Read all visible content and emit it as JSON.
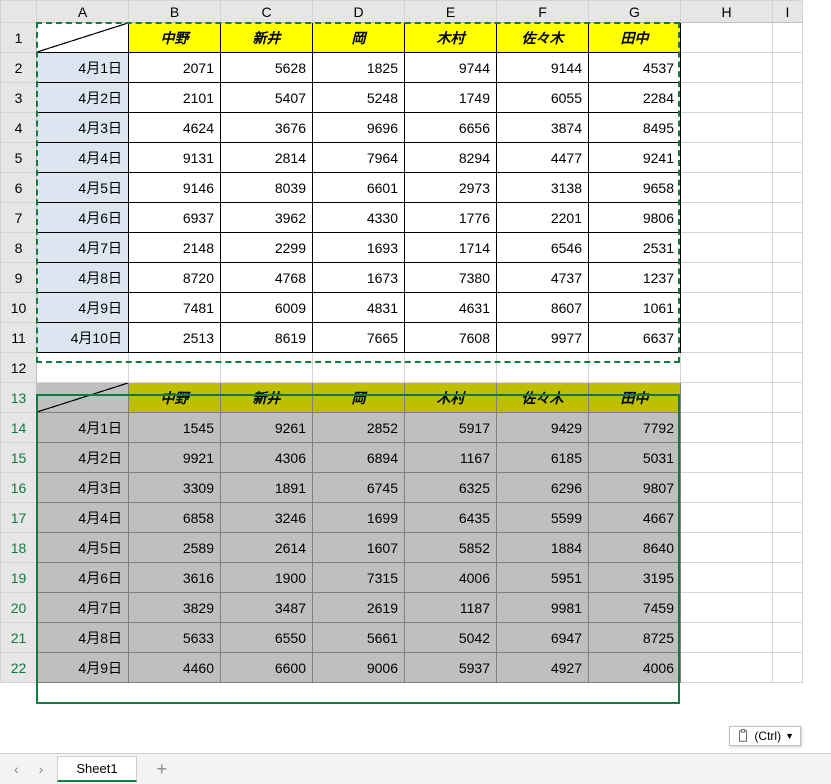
{
  "columns": [
    "A",
    "B",
    "C",
    "D",
    "E",
    "F",
    "G",
    "H",
    "I"
  ],
  "people": [
    "中野",
    "新井",
    "岡",
    "木村",
    "佐々木",
    "田中"
  ],
  "table1": {
    "dates": [
      "4月1日",
      "4月2日",
      "4月3日",
      "4月4日",
      "4月5日",
      "4月6日",
      "4月7日",
      "4月8日",
      "4月9日",
      "4月10日"
    ],
    "rows": [
      [
        2071,
        5628,
        1825,
        9744,
        9144,
        4537
      ],
      [
        2101,
        5407,
        5248,
        1749,
        6055,
        2284
      ],
      [
        4624,
        3676,
        9696,
        6656,
        3874,
        8495
      ],
      [
        9131,
        2814,
        7964,
        8294,
        4477,
        9241
      ],
      [
        9146,
        8039,
        6601,
        2973,
        3138,
        9658
      ],
      [
        6937,
        3962,
        4330,
        1776,
        2201,
        9806
      ],
      [
        2148,
        2299,
        1693,
        1714,
        6546,
        2531
      ],
      [
        8720,
        4768,
        1673,
        7380,
        4737,
        1237
      ],
      [
        7481,
        6009,
        4831,
        4631,
        8607,
        1061
      ],
      [
        2513,
        8619,
        7665,
        7608,
        9977,
        6637
      ]
    ]
  },
  "table2": {
    "dates": [
      "4月1日",
      "4月2日",
      "4月3日",
      "4月4日",
      "4月5日",
      "4月6日",
      "4月7日",
      "4月8日",
      "4月9日"
    ],
    "rows": [
      [
        1545,
        9261,
        2852,
        5917,
        9429,
        7792
      ],
      [
        9921,
        4306,
        6894,
        1167,
        6185,
        5031
      ],
      [
        3309,
        1891,
        6745,
        6325,
        6296,
        9807
      ],
      [
        6858,
        3246,
        1699,
        6435,
        5599,
        4667
      ],
      [
        2589,
        2614,
        1607,
        5852,
        1884,
        8640
      ],
      [
        3616,
        1900,
        7315,
        4006,
        5951,
        3195
      ],
      [
        3829,
        3487,
        2619,
        1187,
        9981,
        7459
      ],
      [
        5633,
        6550,
        5661,
        5042,
        6947,
        8725
      ],
      [
        4460,
        6600,
        9006,
        5937,
        4927,
        4006
      ]
    ]
  },
  "tabs": {
    "sheet": "Sheet1"
  },
  "paste_options": {
    "label": "(Ctrl)"
  },
  "chart_data": [
    {
      "type": "table",
      "title": "Table 1 (rows 1-11)",
      "columns": [
        "中野",
        "新井",
        "岡",
        "木村",
        "佐々木",
        "田中"
      ],
      "index": [
        "4月1日",
        "4月2日",
        "4月3日",
        "4月4日",
        "4月5日",
        "4月6日",
        "4月7日",
        "4月8日",
        "4月9日",
        "4月10日"
      ],
      "data": [
        [
          2071,
          5628,
          1825,
          9744,
          9144,
          4537
        ],
        [
          2101,
          5407,
          5248,
          1749,
          6055,
          2284
        ],
        [
          4624,
          3676,
          9696,
          6656,
          3874,
          8495
        ],
        [
          9131,
          2814,
          7964,
          8294,
          4477,
          9241
        ],
        [
          9146,
          8039,
          6601,
          2973,
          3138,
          9658
        ],
        [
          6937,
          3962,
          4330,
          1776,
          2201,
          9806
        ],
        [
          2148,
          2299,
          1693,
          1714,
          6546,
          2531
        ],
        [
          8720,
          4768,
          1673,
          7380,
          4737,
          1237
        ],
        [
          7481,
          6009,
          4831,
          4631,
          8607,
          1061
        ],
        [
          2513,
          8619,
          7665,
          7608,
          9977,
          6637
        ]
      ]
    },
    {
      "type": "table",
      "title": "Table 2 (rows 13-22, pasted selection)",
      "columns": [
        "中野",
        "新井",
        "岡",
        "木村",
        "佐々木",
        "田中"
      ],
      "index": [
        "4月1日",
        "4月2日",
        "4月3日",
        "4月4日",
        "4月5日",
        "4月6日",
        "4月7日",
        "4月8日",
        "4月9日"
      ],
      "data": [
        [
          1545,
          9261,
          2852,
          5917,
          9429,
          7792
        ],
        [
          9921,
          4306,
          6894,
          1167,
          6185,
          5031
        ],
        [
          3309,
          1891,
          6745,
          6325,
          6296,
          9807
        ],
        [
          6858,
          3246,
          1699,
          6435,
          5599,
          4667
        ],
        [
          2589,
          2614,
          1607,
          5852,
          1884,
          8640
        ],
        [
          3616,
          1900,
          7315,
          4006,
          5951,
          3195
        ],
        [
          3829,
          3487,
          2619,
          1187,
          9981,
          7459
        ],
        [
          5633,
          6550,
          5661,
          5042,
          6947,
          8725
        ],
        [
          4460,
          6600,
          9006,
          5937,
          4927,
          4006
        ]
      ]
    }
  ]
}
